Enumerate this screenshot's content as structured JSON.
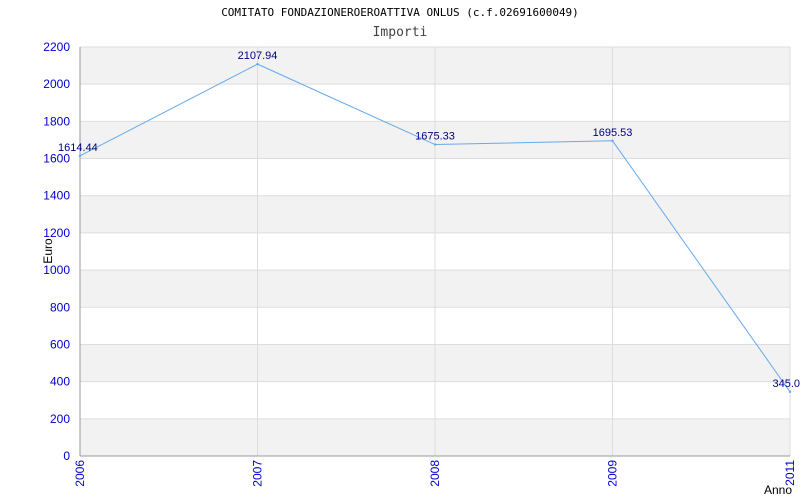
{
  "colors": {
    "axis_text": "#0000cc",
    "data_label": "#000080",
    "line": "#66aaee",
    "band": "#f2f2f2",
    "grid": "#dddddd"
  },
  "chart_data": {
    "type": "line",
    "title": "COMITATO FONDAZIONEROEROATTIVA ONLUS (c.f.02691600049)",
    "subtitle": "Importi",
    "xlabel": "Anno",
    "ylabel": "Euro",
    "x": [
      "2006",
      "2007",
      "2008",
      "2009",
      "2011"
    ],
    "series": [
      {
        "values": [
          1614.44,
          2107.94,
          1675.33,
          1695.53,
          345.0
        ]
      }
    ],
    "data_labels": [
      "1614.44",
      "2107.94",
      "1675.33",
      "1695.53",
      "345.0"
    ],
    "ylim": [
      0,
      2200
    ],
    "yticks": [
      "0",
      "200",
      "400",
      "600",
      "800",
      "1000",
      "1200",
      "1400",
      "1600",
      "1800",
      "2000",
      "2200"
    ],
    "grid": true,
    "legend": "none"
  }
}
